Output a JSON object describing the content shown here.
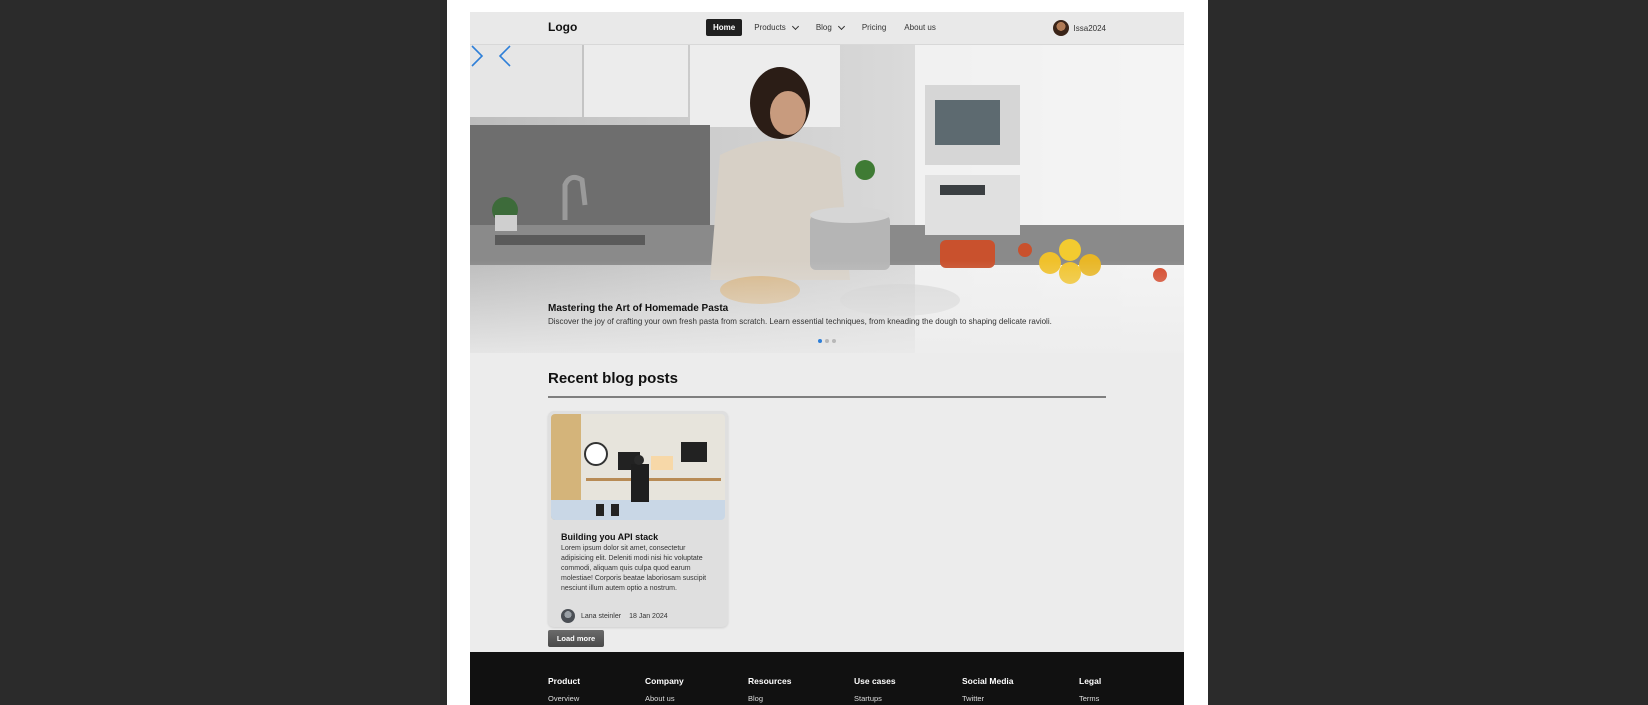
{
  "navbar": {
    "logo": "Logo",
    "items": [
      {
        "label": "Home",
        "active": true,
        "has_dropdown": false
      },
      {
        "label": "Products",
        "active": false,
        "has_dropdown": true
      },
      {
        "label": "Blog",
        "active": false,
        "has_dropdown": true
      },
      {
        "label": "Pricing",
        "active": false,
        "has_dropdown": false
      },
      {
        "label": "About us",
        "active": false,
        "has_dropdown": false
      }
    ],
    "user": {
      "name": "Issa2024"
    }
  },
  "hero": {
    "title": "Mastering the Art of Homemade Pasta",
    "description": "Discover the joy of crafting your own fresh pasta from scratch. Learn essential techniques, from kneading the dough to shaping delicate ravioli.",
    "slide_count": 3,
    "active_slide": 1,
    "arrow_color": "#2e7fd8"
  },
  "recent": {
    "title": "Recent blog posts",
    "posts": [
      {
        "title": "Building you API stack",
        "body": "Lorem ipsum dolor sit amet, consectetur adipisicing elit. Deleniti modi nisi hic voluptate commodi, aliquam quis culpa quod earum molestiae! Corporis beatae laboriosam suscipit nesciunt illum autem optio a nostrum.",
        "author": "Lana steinler",
        "date": "18 Jan 2024"
      }
    ],
    "load_more": "Load more"
  },
  "footer": {
    "columns": [
      {
        "heading": "Product",
        "first_link": "Overview"
      },
      {
        "heading": "Company",
        "first_link": "About us"
      },
      {
        "heading": "Resources",
        "first_link": "Blog"
      },
      {
        "heading": "Use cases",
        "first_link": "Startups"
      },
      {
        "heading": "Social Media",
        "first_link": "Twitter"
      },
      {
        "heading": "Legal",
        "first_link": "Terms"
      }
    ]
  },
  "colors": {
    "page_background": "#2b2b2b",
    "content_background": "#ececec",
    "footer_background": "#111111",
    "accent": "#2e7fd8"
  }
}
